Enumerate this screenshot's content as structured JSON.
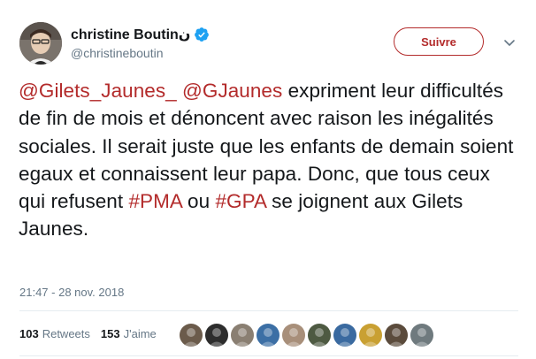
{
  "user": {
    "display_name": "christine Boutinن",
    "handle": "@christineboutin",
    "verified": true,
    "avatar_icon": "profile-photo"
  },
  "follow_button": {
    "label": "Suivre"
  },
  "tweet": {
    "segments": [
      {
        "type": "mention",
        "text": "@Gilets_Jaunes_"
      },
      {
        "type": "text",
        "text": " "
      },
      {
        "type": "mention",
        "text": "@GJaunes"
      },
      {
        "type": "text",
        "text": " expriment leur difficultés de fin de mois et dénoncent avec raison les inégalités sociales. Il serait juste que les enfants de demain soient egaux et connaissent leur papa. Donc, que tous ceux qui refusent "
      },
      {
        "type": "hashtag",
        "text": "#PMA"
      },
      {
        "type": "text",
        "text": " ou "
      },
      {
        "type": "hashtag",
        "text": "#GPA"
      },
      {
        "type": "text",
        "text": " se joignent aux Gilets Jaunes."
      }
    ],
    "timestamp": "21:47 - 28 nov. 2018"
  },
  "stats": {
    "retweets_count": "103",
    "retweets_label": "Retweets",
    "likes_count": "153",
    "likes_label": "J'aime"
  },
  "likers": [
    {
      "icon": "liker-avatar",
      "color": "#6b5b4b"
    },
    {
      "icon": "liker-avatar",
      "color": "#2d2d2d"
    },
    {
      "icon": "liker-avatar",
      "color": "#8a7f72"
    },
    {
      "icon": "liker-avatar",
      "color": "#3c6fa5"
    },
    {
      "icon": "liker-avatar",
      "color": "#a88f7a"
    },
    {
      "icon": "liker-avatar",
      "color": "#4e5a42"
    },
    {
      "icon": "liker-avatar",
      "color": "#3a6aa0"
    },
    {
      "icon": "liker-avatar",
      "color": "#c9a032"
    },
    {
      "icon": "liker-avatar",
      "color": "#5b4b3c"
    },
    {
      "icon": "liker-avatar",
      "color": "#6f7a7e"
    }
  ],
  "colors": {
    "accent": "#b32b2b",
    "verified_badge": "#1da1f2",
    "secondary_text": "#657786"
  }
}
